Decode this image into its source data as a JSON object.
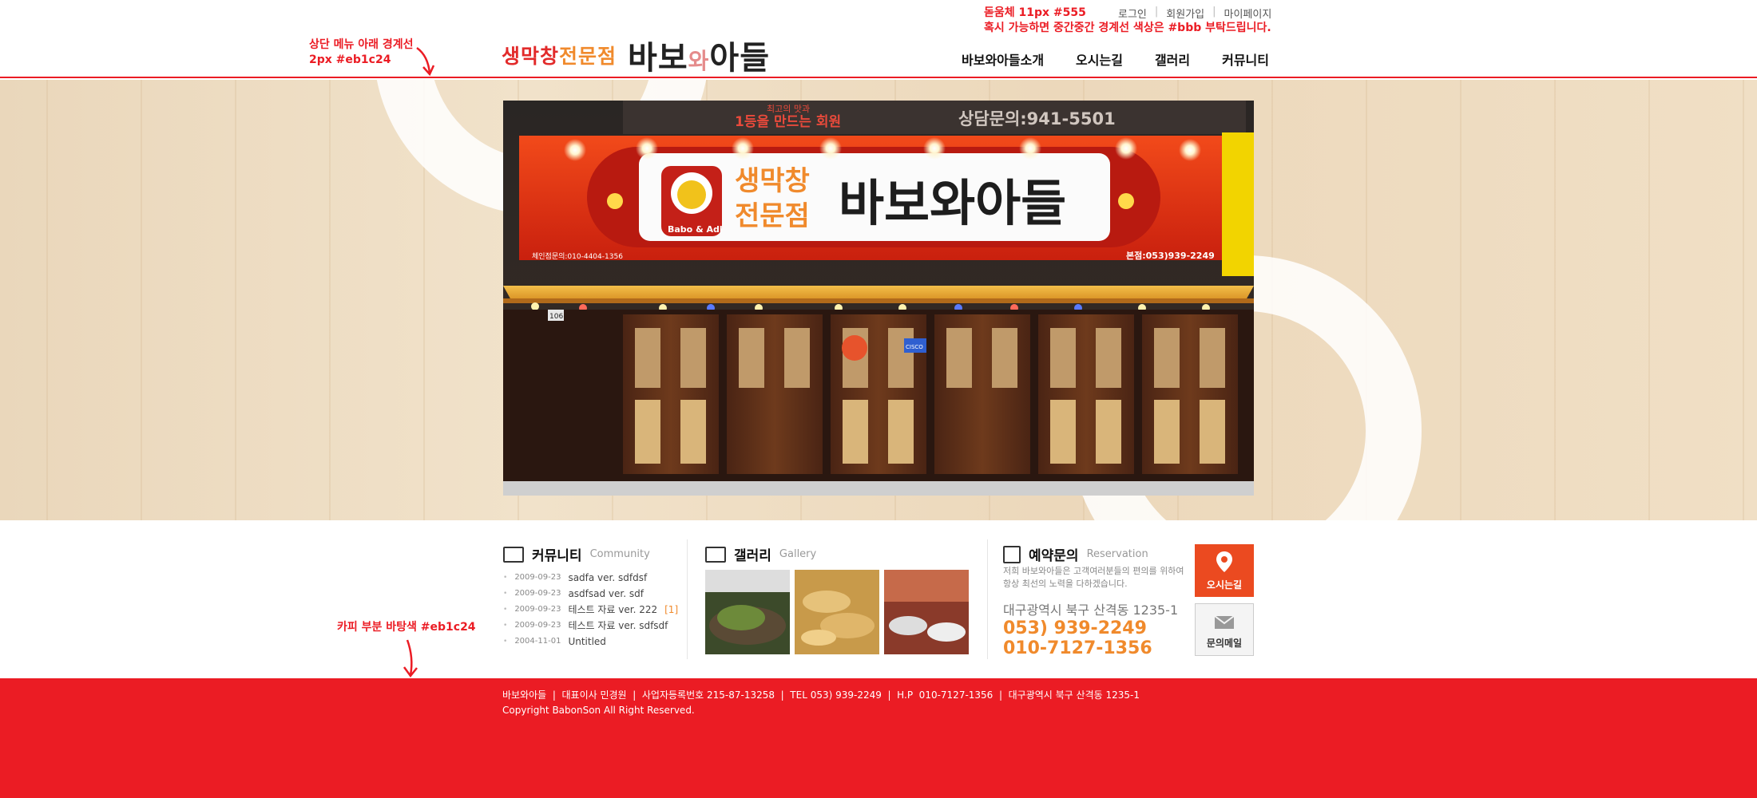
{
  "header": {
    "logo_sub_1": "생막창",
    "logo_sub_2": "전문점",
    "logo_main_1": "바보",
    "logo_main_wa": "와",
    "logo_main_2": "아들",
    "util_links": [
      "로그인",
      "회원가입",
      "마이페이지"
    ],
    "nav": [
      "바보와아들소개",
      "오시는길",
      "갤러리",
      "커뮤니티"
    ]
  },
  "annotations": {
    "top_right_1": "돋움체 11px #555",
    "top_right_2": "혹시 가능하면 중간중간 경계선 색상은 #bbb 부탁드립니다.",
    "top_left_1": "상단 메뉴 아래 경계선",
    "top_left_2": "2px #eb1c24",
    "bottom_left": "카피 부분 바탕색 #eb1c24"
  },
  "photo": {
    "banner_top_1": "최고의 맛과",
    "banner_top_2": "1등을 만드는 회원",
    "banner_top_3": "상담문의:941-5501",
    "sign_sub_1": "생막창",
    "sign_sub_2": "전문점",
    "sign_main": "바보와아들",
    "sign_brand": "Babo & Adl",
    "sign_small_left": "체인점문의:010-4404-1356",
    "sign_small_right": "본점:053)939-2249",
    "street_no": "106",
    "door_sign": "CISCO"
  },
  "community": {
    "title": "커뮤니티",
    "title_en": "Community",
    "posts": [
      {
        "date": "2009-09-23",
        "title": "sadfa ver. sdfdsf",
        "count": ""
      },
      {
        "date": "2009-09-23",
        "title": "asdfsad ver. sdf",
        "count": ""
      },
      {
        "date": "2009-09-23",
        "title": "테스트 자료 ver. 222",
        "count": "[1]"
      },
      {
        "date": "2009-09-23",
        "title": "테스트 자료 ver. sdfsdf",
        "count": ""
      },
      {
        "date": "2004-11-01",
        "title": "Untitled",
        "count": ""
      }
    ]
  },
  "gallery": {
    "title": "갤러리",
    "title_en": "Gallery"
  },
  "reservation": {
    "title": "예약문의",
    "title_en": "Reservation",
    "desc": "저희 바보와아들은 고객여러분들의 편의를 위하여 항상 최선의 노력을 다하겠습니다.",
    "address": "대구광역시 북구 산격동 1235-1",
    "phone_1": "053) 939-2249",
    "phone_2": "010-7127-1356"
  },
  "quick": {
    "map_label": "오시는길",
    "mail_label": "문의메일"
  },
  "footer": {
    "info": "바보와아들  |  대표이사 민경원  |  사업자등록번호 215-87-13258  |  TEL 053) 939-2249  |  H.P  010-7127-1356  |  대구광역시 북구 산격동 1235-1",
    "copyright": "Copyright  BabonSon  All Right Reserved."
  },
  "colors": {
    "accent": "#eb1c24",
    "orange": "#f08a2c",
    "text": "#555555"
  }
}
